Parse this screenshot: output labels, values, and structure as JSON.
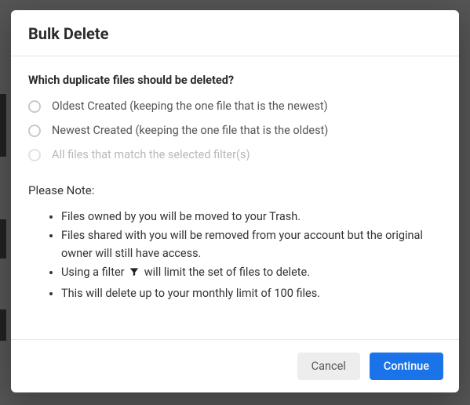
{
  "modal": {
    "title": "Bulk Delete",
    "question": "Which duplicate files should be deleted?",
    "options": [
      {
        "label": "Oldest Created (keeping the one file that is the newest)",
        "disabled": false
      },
      {
        "label": "Newest Created (keeping the one file that is the oldest)",
        "disabled": false
      },
      {
        "label": "All files that match the selected filter(s)",
        "disabled": true
      }
    ],
    "note_heading": "Please Note:",
    "notes": [
      "Files owned by you will be moved to your Trash.",
      "Files shared with you will be removed from your account but the original owner will still have access.",
      {
        "pre": "Using a filter ",
        "post": " will limit the set of files to delete."
      },
      "This will delete up to your monthly limit of 100 files."
    ],
    "buttons": {
      "cancel": "Cancel",
      "continue": "Continue"
    }
  }
}
